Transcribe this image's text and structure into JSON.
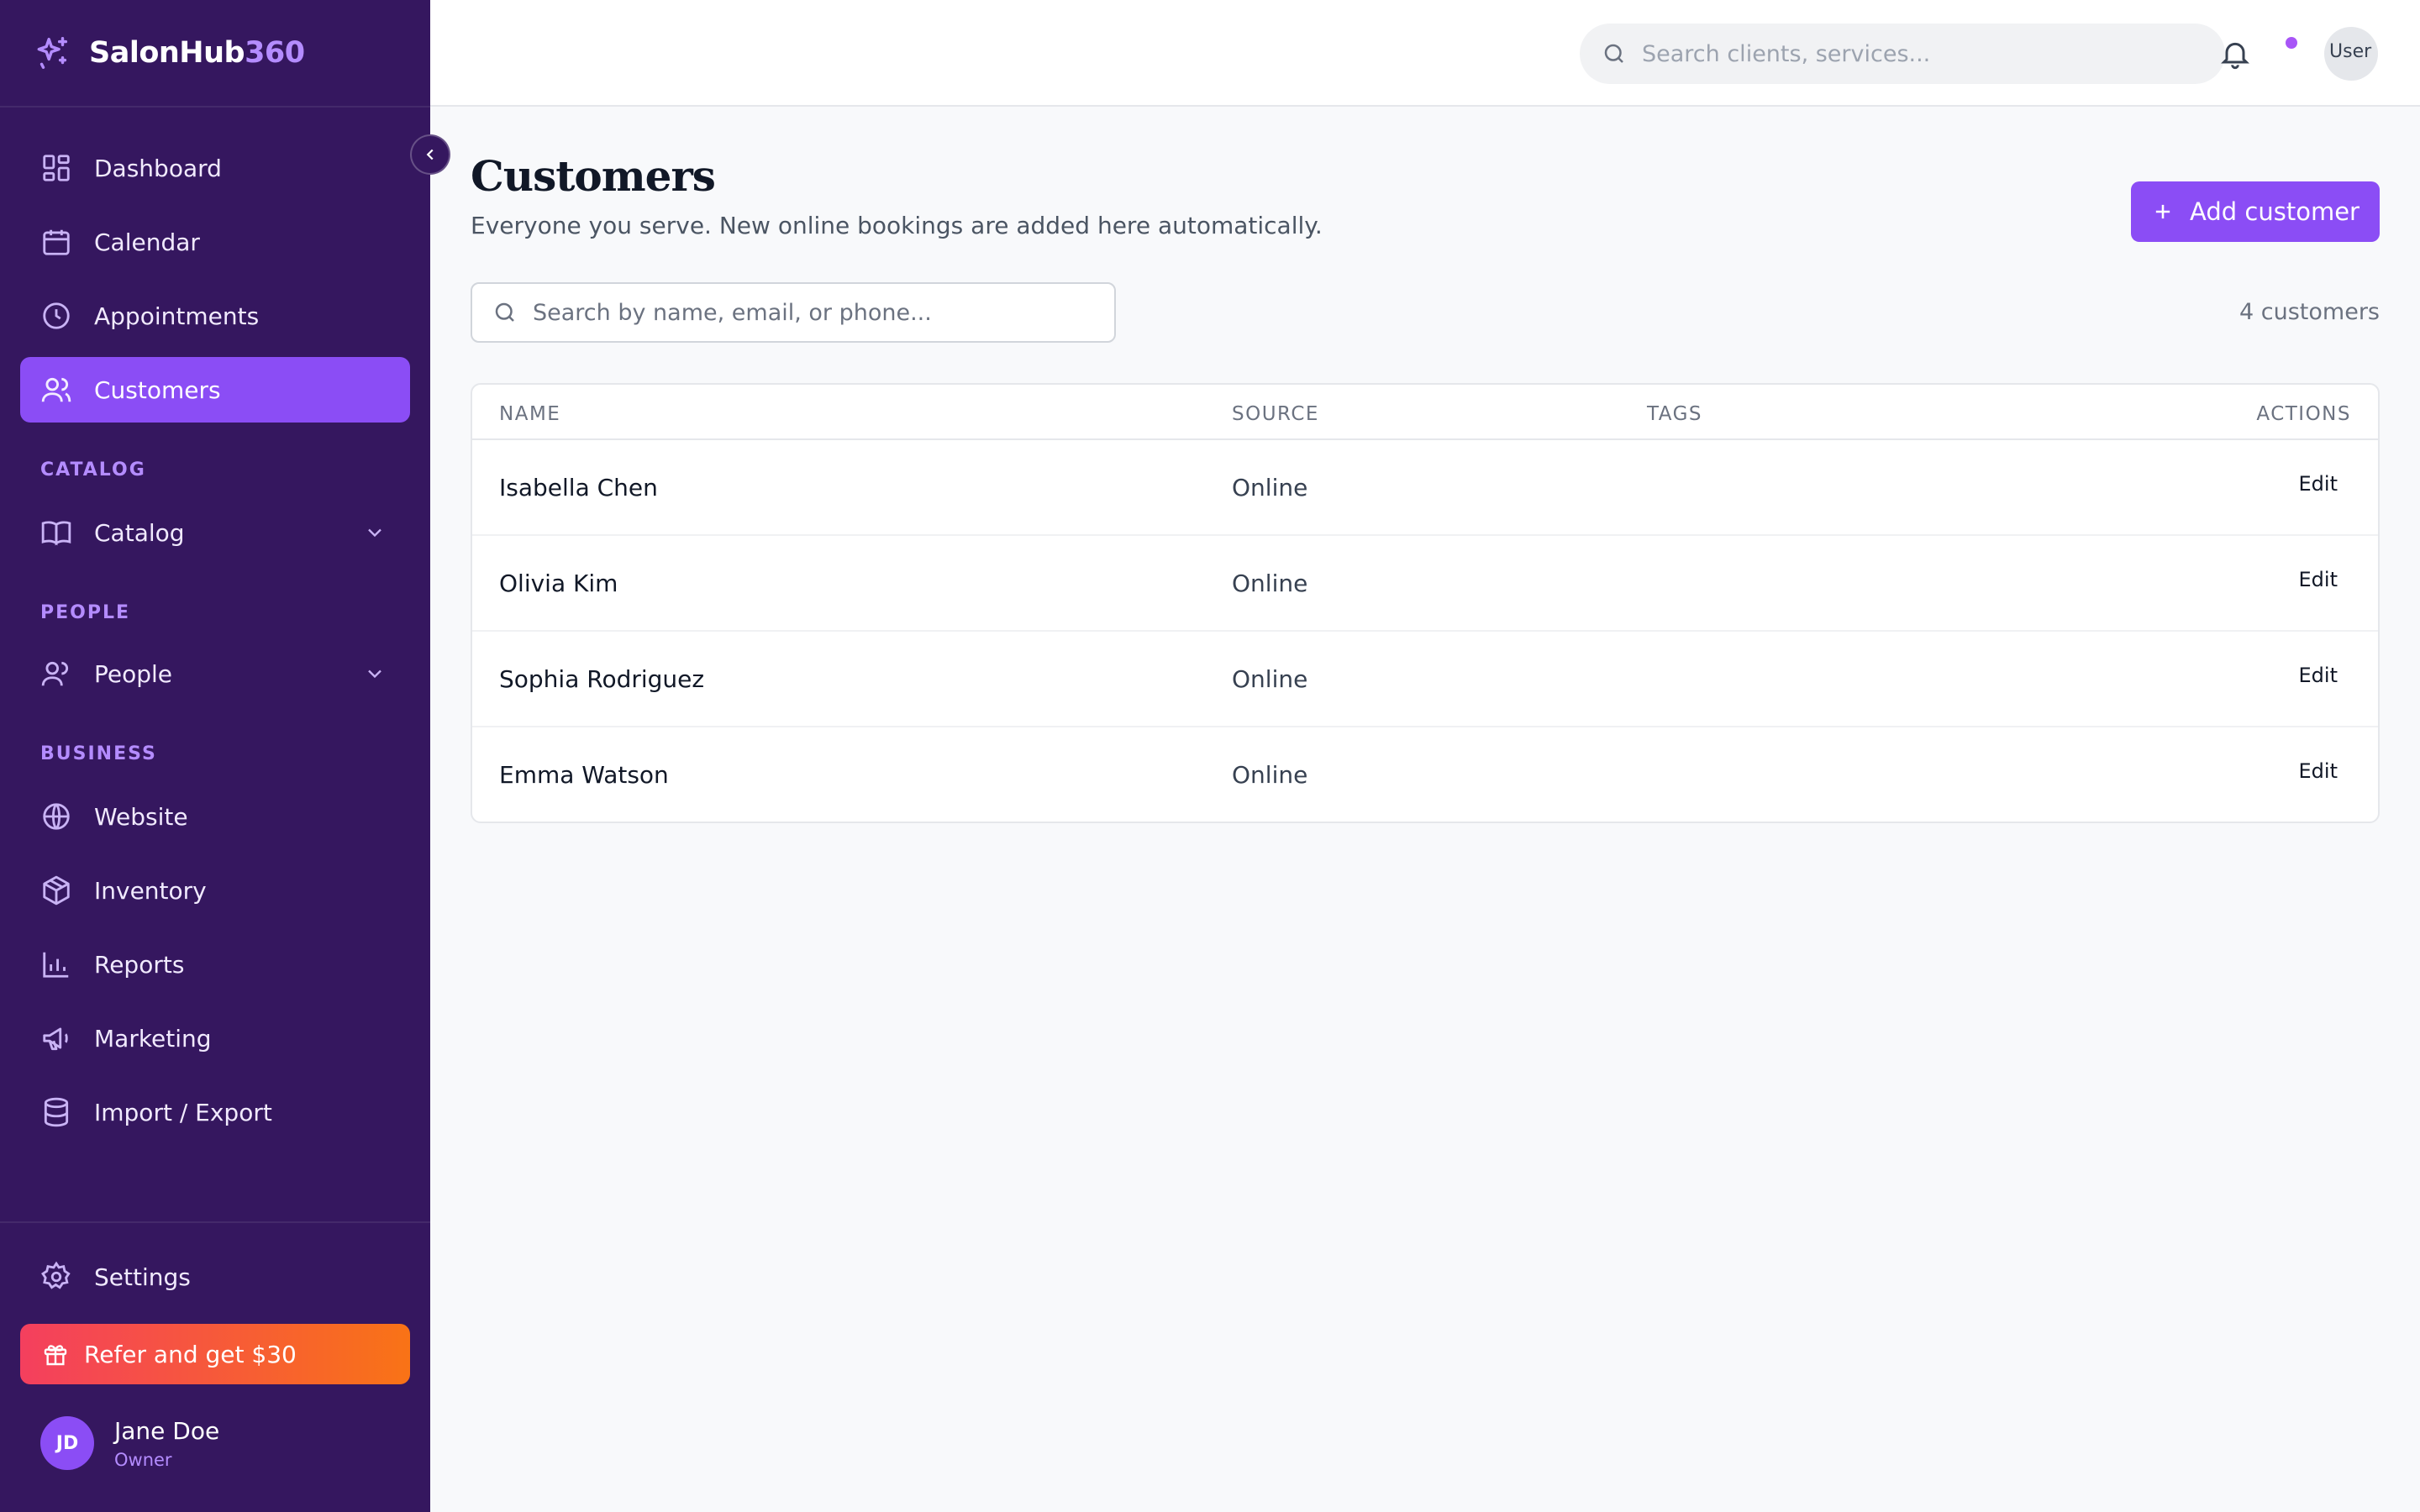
{
  "brand": {
    "name": "SalonHub",
    "accent": "360"
  },
  "sidebar": {
    "main_items": [
      {
        "label": "Dashboard",
        "icon": "dashboard-icon"
      },
      {
        "label": "Calendar",
        "icon": "calendar-icon"
      },
      {
        "label": "Appointments",
        "icon": "clock-icon"
      },
      {
        "label": "Customers",
        "icon": "users-icon",
        "active": true
      }
    ],
    "sections": {
      "catalog": {
        "label": "CATALOG",
        "item": "Catalog"
      },
      "people": {
        "label": "PEOPLE",
        "item": "People"
      },
      "business": {
        "label": "BUSINESS",
        "items": [
          "Website",
          "Inventory",
          "Reports",
          "Marketing",
          "Import / Export"
        ]
      }
    },
    "settings": "Settings",
    "refer": "Refer and get $30",
    "user": {
      "initials": "JD",
      "name": "Jane Doe",
      "role": "Owner"
    }
  },
  "topbar": {
    "search_placeholder": "Search clients, services...",
    "avatar_alt": "User"
  },
  "page": {
    "title": "Customers",
    "subtitle": "Everyone you serve. New online bookings are added here automatically.",
    "add_button": "Add customer",
    "search_placeholder": "Search by name, email, or phone...",
    "count": "4 customers"
  },
  "table": {
    "columns": [
      "NAME",
      "SOURCE",
      "TAGS",
      "ACTIONS"
    ],
    "rows": [
      {
        "name": "Isabella Chen",
        "source": "Online",
        "tags": "",
        "action": "Edit"
      },
      {
        "name": "Olivia Kim",
        "source": "Online",
        "tags": "",
        "action": "Edit"
      },
      {
        "name": "Sophia Rodriguez",
        "source": "Online",
        "tags": "",
        "action": "Edit"
      },
      {
        "name": "Emma Watson",
        "source": "Online",
        "tags": "",
        "action": "Edit"
      }
    ]
  },
  "colors": {
    "sidebar_bg": "#35175f",
    "accent": "#8b4df5",
    "accent_light": "#b48cff",
    "refer_gradient_start": "#f43f5e",
    "refer_gradient_end": "#f97316"
  }
}
